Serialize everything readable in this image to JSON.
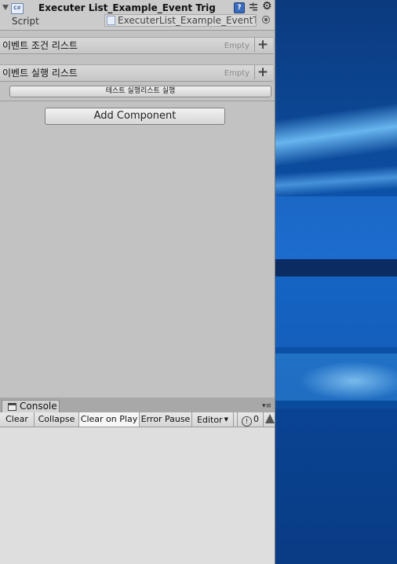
{
  "inspector": {
    "component_icon_text": "C#",
    "component_title": "Executer List_Example_Event Trig",
    "help_icon_text": "?",
    "script_label": "Script",
    "script_value": "ExecuterList_Example_EventTri",
    "lists": [
      {
        "label": "이벤트 조건 리스트",
        "empty_text": "Empty",
        "add_text": "+"
      },
      {
        "label": "이벤트 실행 리스트",
        "empty_text": "Empty",
        "add_text": "+"
      }
    ],
    "run_button_label": "테스트 실행리스트 실행",
    "add_component_label": "Add Component"
  },
  "console": {
    "tab_label": "Console",
    "toolbar": {
      "clear": "Clear",
      "collapse": "Collapse",
      "clear_on_play": "Clear on Play",
      "error_pause": "Error Pause",
      "editor": "Editor",
      "info_count": "0"
    }
  },
  "colors": {
    "panel_bg": "#c2c2c2",
    "console_bg": "#dedede",
    "desktop_blue": "#0c4c9e"
  }
}
